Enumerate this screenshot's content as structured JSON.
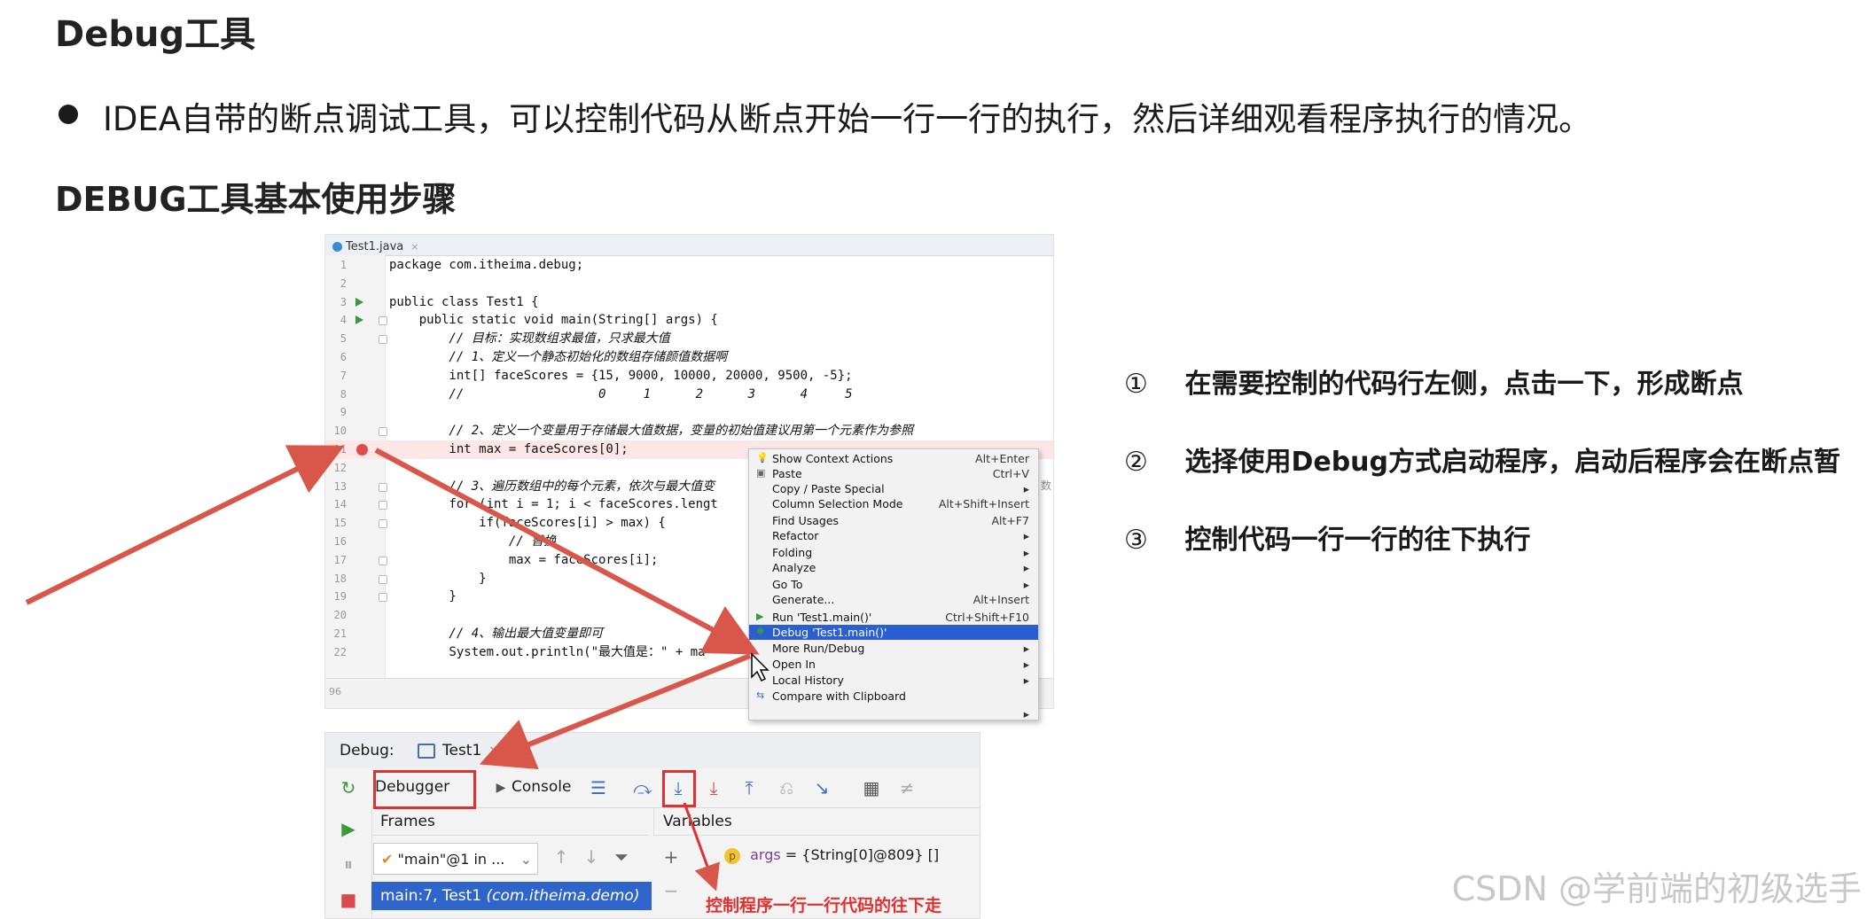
{
  "title": "Debug工具",
  "bullet": "IDEA自带的断点调试工具，可以控制代码从断点开始一行一行的执行，然后详细观看程序执行的情况。",
  "subtitle": "DEBUG工具基本使用步骤",
  "editor": {
    "tab_label": "Test1.java",
    "tab_close": "×",
    "lines": [
      {
        "n": "1",
        "text": "package com.itheima.debug;"
      },
      {
        "n": "2",
        "text": ""
      },
      {
        "n": "3",
        "text": "public class Test1 {"
      },
      {
        "n": "4",
        "text": "    public static void main(String[] args) {"
      },
      {
        "n": "5",
        "text": "        // 目标：实现数组求最值，只求最大值"
      },
      {
        "n": "6",
        "text": "        // 1、定义一个静态初始化的数组存储颜值数据啊"
      },
      {
        "n": "7",
        "text": "        int[] faceScores = {15, 9000, 10000, 20000, 9500, -5};"
      },
      {
        "n": "8",
        "text": "        //                  0     1      2      3      4     5"
      },
      {
        "n": "9",
        "text": ""
      },
      {
        "n": "10",
        "text": "        // 2、定义一个变量用于存储最大值数据，变量的初始值建议用第一个元素作为参照"
      },
      {
        "n": "11",
        "text": "        int max = faceScores[0];"
      },
      {
        "n": "12",
        "text": ""
      },
      {
        "n": "13",
        "text": "        // 3、遍历数组中的每个元素，依次与最大值变"
      },
      {
        "n": "14",
        "text": "        for (int i = 1; i < faceScores.lengt"
      },
      {
        "n": "15",
        "text": "            if(faceScores[i] > max) {"
      },
      {
        "n": "16",
        "text": "                // 替换"
      },
      {
        "n": "17",
        "text": "                max = faceScores[i];"
      },
      {
        "n": "18",
        "text": "            }"
      },
      {
        "n": "19",
        "text": "        }"
      },
      {
        "n": "20",
        "text": ""
      },
      {
        "n": "21",
        "text": "        // 4、输出最大值变量即可"
      },
      {
        "n": "22",
        "text": "        System.out.println(\"最大值是：\" + ma"
      }
    ],
    "overflow_tail": "数",
    "footer_text": "96"
  },
  "context_menu": {
    "items": [
      {
        "label": "Show Context Actions",
        "shortcut": "Alt+Enter",
        "icon": "bulb"
      },
      {
        "label": "Paste",
        "shortcut": "Ctrl+V",
        "icon": "paste"
      },
      {
        "label": "Copy / Paste Special",
        "shortcut": "▸",
        "icon": ""
      },
      {
        "label": "Column Selection Mode",
        "shortcut": "Alt+Shift+Insert",
        "icon": ""
      },
      {
        "label": "Find Usages",
        "shortcut": "Alt+F7",
        "icon": ""
      },
      {
        "label": "Refactor",
        "shortcut": "▸",
        "icon": ""
      },
      {
        "label": "Folding",
        "shortcut": "▸",
        "icon": ""
      },
      {
        "label": "Analyze",
        "shortcut": "▸",
        "icon": ""
      },
      {
        "label": "Go To",
        "shortcut": "▸",
        "icon": ""
      },
      {
        "label": "Generate...",
        "shortcut": "Alt+Insert",
        "icon": ""
      },
      {
        "label": "Run 'Test1.main()'",
        "shortcut": "Ctrl+Shift+F10",
        "icon": "run"
      },
      {
        "label": "Debug 'Test1.main()'",
        "shortcut": "",
        "icon": "debug"
      },
      {
        "label": "More Run/Debug",
        "shortcut": "▸",
        "icon": ""
      },
      {
        "label": "Open In",
        "shortcut": "▸",
        "icon": ""
      },
      {
        "label": "Local History",
        "shortcut": "▸",
        "icon": ""
      },
      {
        "label": "Compare with Clipboard",
        "shortcut": "",
        "icon": "compare"
      },
      {
        "label": "",
        "shortcut": "▸",
        "icon": ""
      }
    ]
  },
  "debug_panel": {
    "label": "Debug:",
    "run_tab": "Test1",
    "tab_close": "×",
    "debugger_tab": "Debugger",
    "console_tab": "Console",
    "frames_header": "Frames",
    "variables_header": "Variables",
    "thread": "\"main\"@1 in ...",
    "selected_frame": "main:7, Test1",
    "selected_frame_pkg": "(com.itheima.demo)",
    "var_name": "args",
    "var_value": "= {String[0]@809} []",
    "var_badge": "p"
  },
  "annotation": "控制程序一行一行代码的往下走",
  "steps": [
    {
      "num": "①",
      "text": "在需要控制的代码行左侧，点击一下，形成断点"
    },
    {
      "num": "②",
      "text": "选择使用Debug方式启动程序，启动后程序会在断点暂"
    },
    {
      "num": "③",
      "text": "控制代码一行一行的往下执行"
    }
  ],
  "watermark": "CSDN @学前端的初级选手",
  "colors": {
    "arrow": "#d9574a",
    "highlight_box": "#e03131",
    "selection": "#2a5fd1",
    "breakpoint": "#e04b4b"
  }
}
